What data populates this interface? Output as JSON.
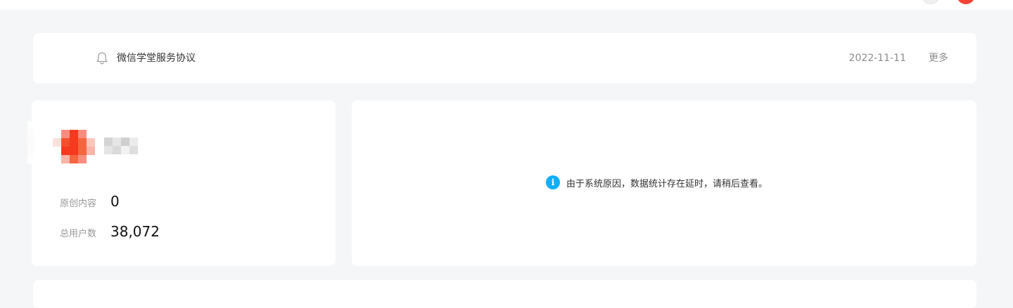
{
  "notice": {
    "title": "微信学堂服务协议",
    "date": "2022-11-11",
    "more_label": "更多",
    "icon": "bell-icon"
  },
  "account": {
    "stats": [
      {
        "label": "原创内容",
        "value": "0"
      },
      {
        "label": "总用户数",
        "value": "38,072"
      }
    ]
  },
  "data_panel": {
    "icon": "info-icon",
    "icon_glyph": "i",
    "message": "由于系统原因，数据统计存在延时，请稍后查看。"
  },
  "colors": {
    "page_bg": "#f5f6f7",
    "card_bg": "#ffffff",
    "info_blue": "#10aeff",
    "avatar_red": "#f44336",
    "muted_text": "#999999"
  }
}
